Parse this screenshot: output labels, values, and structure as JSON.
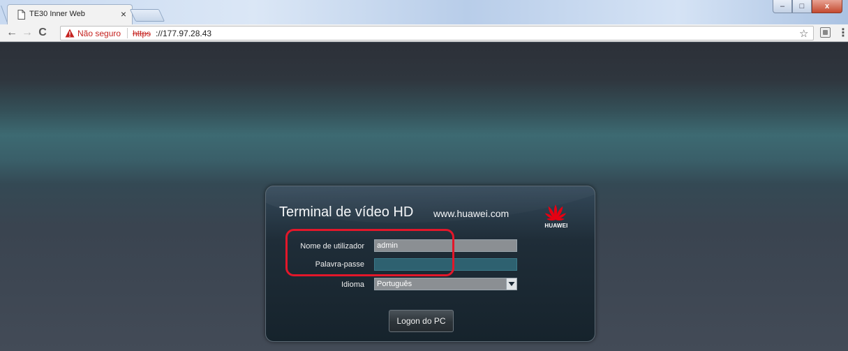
{
  "browser": {
    "tab": {
      "title": "TE30 Inner Web",
      "close_glyph": "×"
    },
    "window_controls": {
      "minimize": "–",
      "maximize": "□",
      "close": "x"
    },
    "toolbar": {
      "back_glyph": "←",
      "forward_glyph": "→",
      "reload_glyph": "C",
      "security_text": "Não seguro",
      "url_scheme": "https",
      "url_rest": "://177.97.28.43",
      "star_glyph": "☆",
      "menu_glyph": "⋮"
    },
    "icons": [
      "document-icon",
      "warning-icon",
      "star-icon",
      "extension-icon",
      "menu-icon"
    ]
  },
  "login": {
    "title": "Terminal de vídeo HD",
    "website": "www.huawei.com",
    "brand": "HUAWEI",
    "username_label": "Nome de utilizador",
    "username_value": "admin",
    "password_label": "Palavra-passe",
    "password_value": "",
    "language_label": "Idioma",
    "language_selected": "Português",
    "logon_button": "Logon do PC"
  },
  "colors": {
    "highlight": "#e3172a",
    "brand_red": "#e60012",
    "warning_red": "#c5221f",
    "password_field": "#2e6170"
  }
}
